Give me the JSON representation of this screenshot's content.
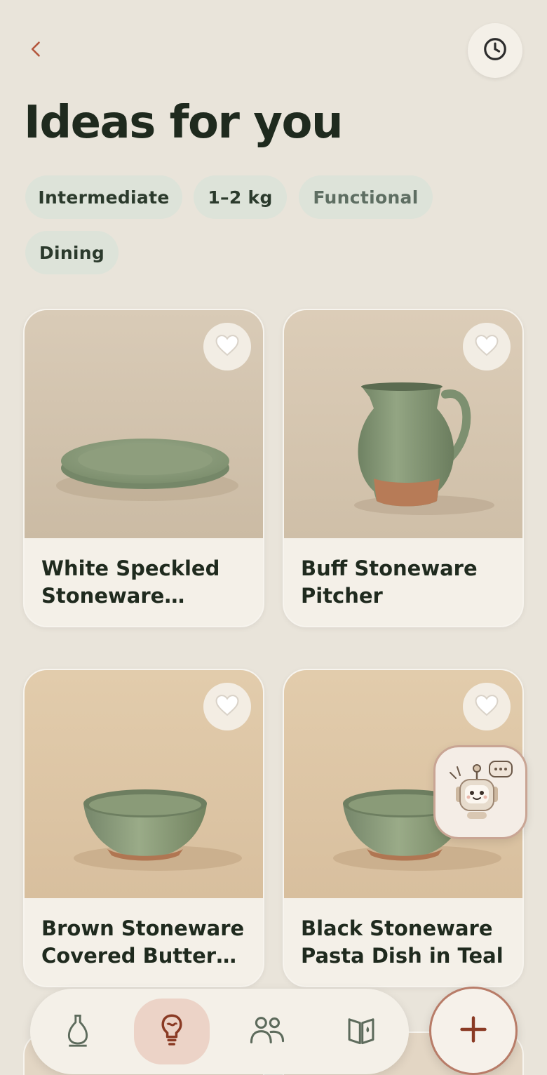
{
  "header": {
    "title": "Ideas for you",
    "back_icon": "chevron-left-icon",
    "history_icon": "clock-icon"
  },
  "filters": [
    {
      "label": "Intermediate",
      "muted": false
    },
    {
      "label": "1–2 kg",
      "muted": false
    },
    {
      "label": "Functional",
      "muted": true
    },
    {
      "label": "Dining",
      "muted": false
    }
  ],
  "ideas": [
    {
      "name": "White Speckled Stoneware Serving Platter",
      "favorite_icon": "heart-icon",
      "image": "green-plate"
    },
    {
      "name": "Buff Stoneware Pitcher",
      "favorite_icon": "heart-icon",
      "image": "green-pitcher"
    },
    {
      "name": "Brown Stoneware Covered Butter Dish",
      "favorite_icon": "heart-icon",
      "image": "green-bowl"
    },
    {
      "name": "Black Stoneware Pasta Dish in Teal",
      "favorite_icon": "heart-icon",
      "image": "green-bowl"
    }
  ],
  "assistant": {
    "icon": "robot-chat-icon"
  },
  "bottom_nav": {
    "items": [
      {
        "icon": "vase-icon",
        "active": false
      },
      {
        "icon": "lightbulb-icon",
        "active": true
      },
      {
        "icon": "people-icon",
        "active": false
      },
      {
        "icon": "book-icon",
        "active": false
      }
    ],
    "fab_icon": "plus-icon"
  },
  "colors": {
    "background": "#e9e4da",
    "card": "#f4f0e8",
    "chip": "#dde3d9",
    "accent": "#b4563c",
    "nav_active": "#ecd3c7",
    "title": "#1f2a1e"
  }
}
